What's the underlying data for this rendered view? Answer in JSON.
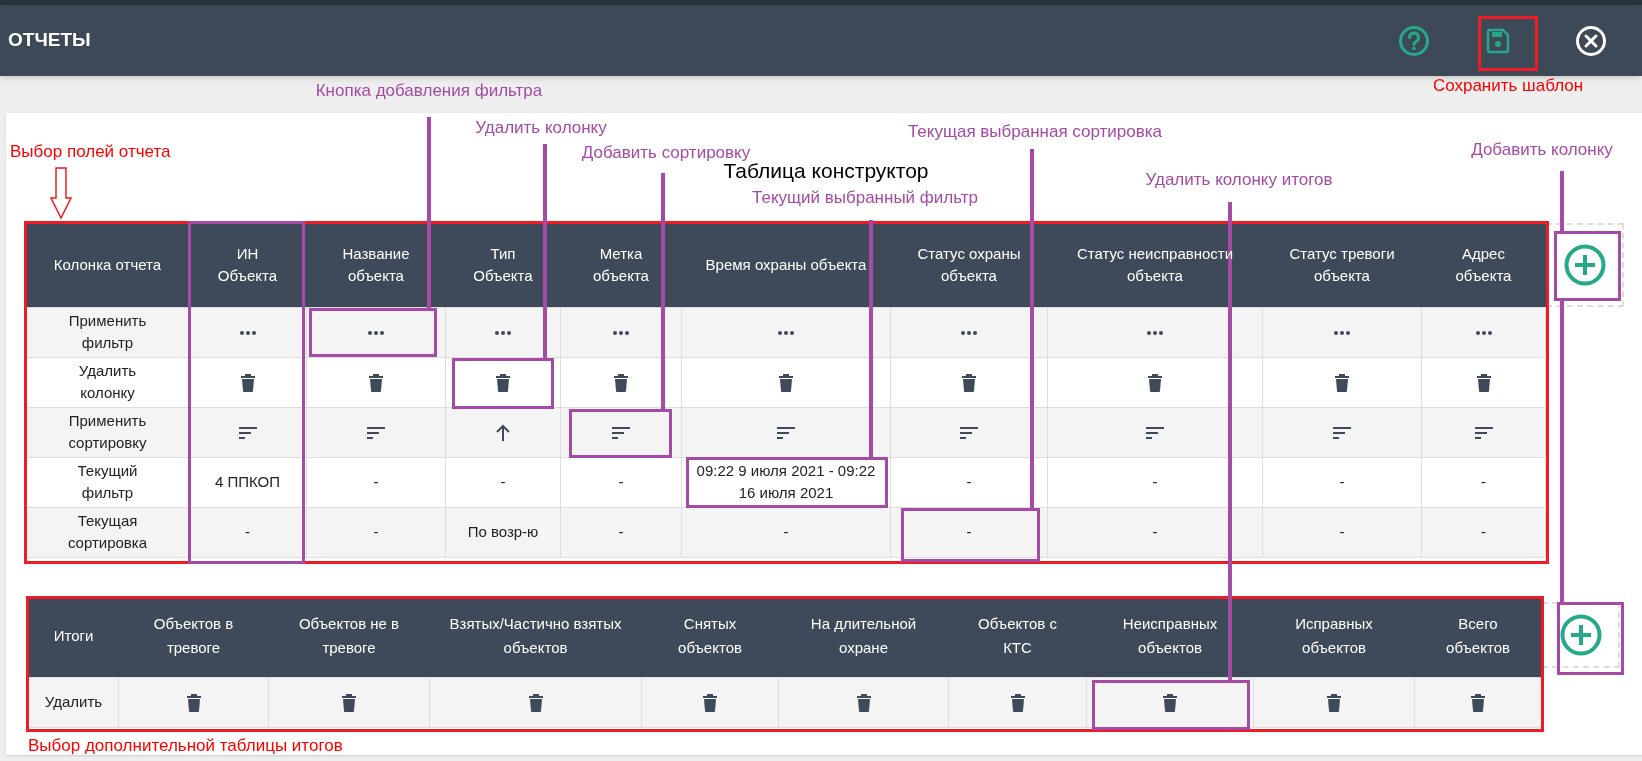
{
  "header": {
    "title": "ОТЧЕТЫ"
  },
  "builder_table": {
    "title": "Таблица конструктор",
    "corner": "Колонка отчета",
    "row_labels": [
      "Применить фильтр",
      "Удалить колонку",
      "Применить сортировку",
      "Текущий фильтр",
      "Текущая сортировка"
    ],
    "columns": [
      {
        "heading": "ИН Объекта",
        "sorted_ascending": false,
        "current_filter": "4 ППКОП",
        "current_sort": "-"
      },
      {
        "heading": "Название объекта",
        "sorted_ascending": false,
        "current_filter": "-",
        "current_sort": "-"
      },
      {
        "heading": "Тип Объекта",
        "sorted_ascending": true,
        "current_filter": "-",
        "current_sort": "По возр-ю"
      },
      {
        "heading": "Метка объекта",
        "sorted_ascending": false,
        "current_filter": "-",
        "current_sort": "-"
      },
      {
        "heading": "Время охраны объекта",
        "sorted_ascending": false,
        "current_filter": "09:22 9 июля 2021 - 09:22 16 июля 2021",
        "current_sort": "-"
      },
      {
        "heading": "Статус охраны объекта",
        "sorted_ascending": false,
        "current_filter": "-",
        "current_sort": "-"
      },
      {
        "heading": "Статус неисправности объекта",
        "sorted_ascending": false,
        "current_filter": "-",
        "current_sort": "-"
      },
      {
        "heading": "Статус тревоги объекта",
        "sorted_ascending": false,
        "current_filter": "-",
        "current_sort": "-"
      },
      {
        "heading": "Адрес объекта",
        "sorted_ascending": false,
        "current_filter": "-",
        "current_sort": "-"
      }
    ]
  },
  "totals_table": {
    "corner": "Итоги",
    "row_label": "Удалить",
    "columns": [
      "Объектов в тревоге",
      "Объектов не в тревоге",
      "Взятых/Частично взятых объектов",
      "Снятых объектов",
      "На длительной охране",
      "Объектов с КТС",
      "Неисправных объектов",
      "Исправных объектов",
      "Всего объектов"
    ]
  },
  "annotations": [
    {
      "text": "Кнопка добавления фильтра",
      "color": "#a54aa5"
    },
    {
      "text": "Сохранить шаблон",
      "color": "#ff0000"
    },
    {
      "text": "Выбор полей отчета",
      "color": "#ff0000"
    },
    {
      "text": "Удалить колонку",
      "color": "#a54aa5"
    },
    {
      "text": "Добавить сортировку",
      "color": "#a54aa5"
    },
    {
      "text": "Текущая выбранная сортировка",
      "color": "#a54aa5"
    },
    {
      "text": "Добавить колонку",
      "color": "#a54aa5"
    },
    {
      "text": "Текущий выбранный фильтр",
      "color": "#a54aa5"
    },
    {
      "text": "Удалить колонку итогов",
      "color": "#a54aa5"
    },
    {
      "text": "Выбор дополнительной таблицы итогов",
      "color": "#ff0000"
    }
  ]
}
